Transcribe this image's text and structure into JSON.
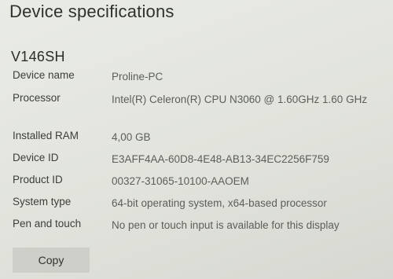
{
  "header": {
    "title": "Device specifications"
  },
  "device": {
    "model": "V146SH"
  },
  "specs": [
    {
      "label": "Device name",
      "value": "Proline-PC"
    },
    {
      "label": "Processor",
      "value": "Intel(R) Celeron(R) CPU  N3060  @ 1.60GHz   1.60 GHz"
    },
    {
      "label": "Installed RAM",
      "value": "4,00 GB"
    },
    {
      "label": "Device ID",
      "value": "E3AFF4AA-60D8-4E48-AB13-34EC2256F759"
    },
    {
      "label": "Product ID",
      "value": "00327-31065-10100-AAOEM"
    },
    {
      "label": "System type",
      "value": "64-bit operating system, x64-based processor"
    },
    {
      "label": "Pen and touch",
      "value": "No pen or touch input is available for this display"
    }
  ],
  "actions": {
    "copy_label": "Copy"
  }
}
